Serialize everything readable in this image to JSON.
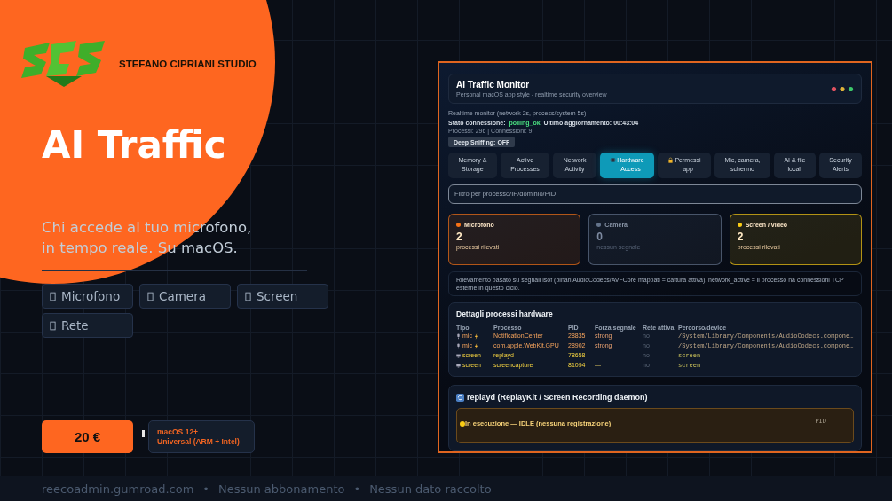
{
  "brand": {
    "name": "STEFANO CIPRIANI STUDIO"
  },
  "hero": {
    "title": "AI Traffic",
    "subtitle": [
      "Chi accede al tuo microfono,",
      "in tempo reale. Su macOS."
    ]
  },
  "features": [
    {
      "label": "Microfono"
    },
    {
      "label": "Camera"
    },
    {
      "label": "Screen"
    },
    {
      "label": "Rete"
    }
  ],
  "price": "20 €",
  "requirements": [
    "macOS 12+",
    "Universal (ARM + Intel)"
  ],
  "footer": {
    "separator": "•",
    "items": [
      "reecoadmin.gumroad.com",
      "Nessun abbonamento",
      "Nessun dato raccolto"
    ]
  },
  "app": {
    "title": "AI Traffic Monitor",
    "subtitle": "Personal macOS app style - realtime security overview",
    "monitor_line": "Realtime monitor (network 2s, process/system 5s)",
    "connection": {
      "label": "Stato connessione:",
      "value": "polling_ok",
      "updated": "Ultimo aggiornamento: 00:43:04"
    },
    "counts": "Processi: 296 | Connessioni: 9",
    "sniffing_button": "Deep Sniffing: OFF",
    "tabs": [
      {
        "label": "Memory &\nStorage",
        "selected": false
      },
      {
        "label": "Active\nProcesses",
        "selected": false
      },
      {
        "label": "Network\nActivity",
        "selected": false
      },
      {
        "label": "Hardware\nAccess",
        "selected": true,
        "kind": "chip"
      },
      {
        "label": "Permessi\napp",
        "selected": false,
        "kind": "lock"
      },
      {
        "label": "Mic, camera,\nschermo",
        "selected": false
      },
      {
        "label": "AI & file\nlocali",
        "selected": false
      },
      {
        "label": "Security\nAlerts",
        "selected": false
      }
    ],
    "search": {
      "placeholder": "Filtro per processo/IP/dominio/PID"
    },
    "cards": [
      {
        "title": "Microfono",
        "count": "2",
        "caption": "processi rilevati",
        "color": "#f97316"
      },
      {
        "title": "Camera",
        "count": "0",
        "caption": "nessun segnale",
        "color": "#64748b"
      },
      {
        "title": "Screen / video",
        "count": "2",
        "caption": "processi rilevati",
        "color": "#facc15"
      }
    ],
    "note": "Rilevamento basato su segnali lsof (binari AudioCodecs/AVFCore mappati = cattura attiva). network_active = il processo ha connessioni TCP esterne in questo ciclo.",
    "table": {
      "title": "Dettagli processi hardware",
      "columns": [
        "Tipo",
        "Processo",
        "PID",
        "Forza segnale",
        "Rete attiva",
        "Percorso/device"
      ],
      "rows": [
        {
          "kind": "mic",
          "cells": [
            "mic",
            "NotificationCenter",
            "28835",
            "strong",
            "no",
            "/System/Library/Components/AudioCodecs.compone…"
          ]
        },
        {
          "kind": "mic",
          "cells": [
            "mic",
            "com.apple.WebKit.GPU",
            "28902",
            "strong",
            "no",
            "/System/Library/Components/AudioCodecs.compone…"
          ]
        },
        {
          "kind": "screen",
          "cells": [
            "screen",
            "replayd",
            "78658",
            "—",
            "no",
            "screen"
          ]
        },
        {
          "kind": "screen",
          "cells": [
            "screen",
            "screencapture",
            "81094",
            "—",
            "no",
            "screen"
          ]
        }
      ]
    },
    "daemon": {
      "title": "replayd (ReplayKit / Screen Recording daemon)",
      "status": "In esecuzione — IDLE (nessuna registrazione)",
      "status_label": "PID"
    }
  }
}
